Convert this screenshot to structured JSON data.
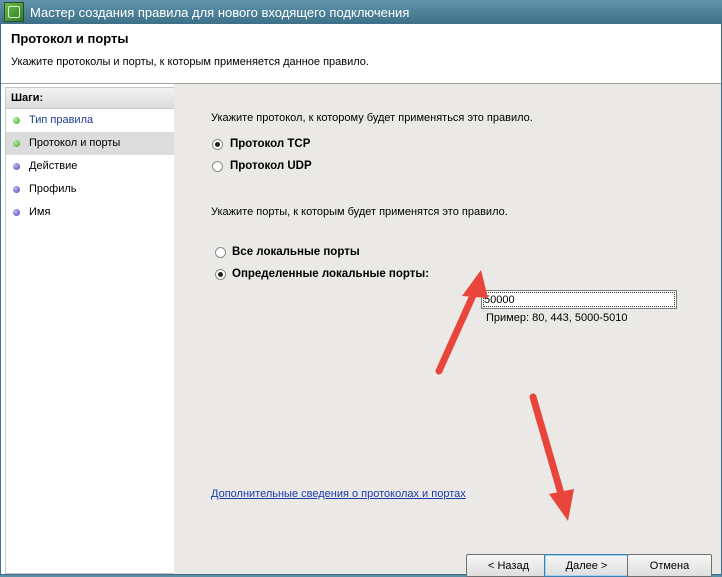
{
  "window": {
    "title": "Мастер создания правила для нового входящего подключения"
  },
  "header": {
    "title": "Протокол и порты",
    "subtitle": "Укажите протоколы и порты, к которым применяется данное правило."
  },
  "sidebar": {
    "header": "Шаги:",
    "items": [
      {
        "label": "Тип правила",
        "status": "done"
      },
      {
        "label": "Протокол и порты",
        "status": "active"
      },
      {
        "label": "Действие",
        "status": "pending"
      },
      {
        "label": "Профиль",
        "status": "pending"
      },
      {
        "label": "Имя",
        "status": "pending"
      }
    ]
  },
  "protocol": {
    "prompt": "Укажите протокол, к которому будет применяться это правило.",
    "tcp": "Протокол TCP",
    "udp": "Протокол UDP",
    "selected": "tcp"
  },
  "ports": {
    "prompt": "Укажите порты, к которым будет применятся это правило.",
    "all": "Все локальные порты",
    "specific": "Определенные локальные порты:",
    "selected": "specific",
    "value": "50000",
    "example": "Пример: 80, 443, 5000-5010"
  },
  "link": "Дополнительные сведения о протоколах и портах",
  "buttons": {
    "back": "< Назад",
    "next": "Далее >",
    "cancel": "Отмена"
  },
  "colors": {
    "arrow": "#e8453c",
    "content_bg": "#eae9e6"
  }
}
